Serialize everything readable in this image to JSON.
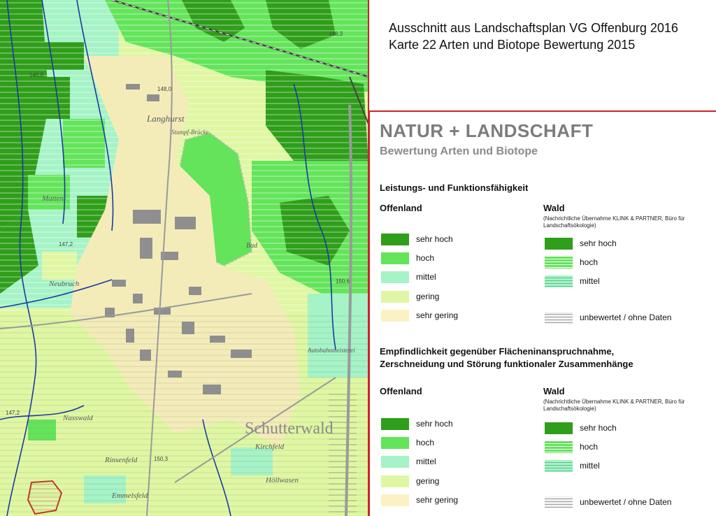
{
  "caption": {
    "line1": "Ausschnitt aus Landschaftsplan VG Offenburg 2016",
    "line2": "Karte 22 Arten und Biotope Bewertung 2015"
  },
  "map": {
    "place_labels": [
      "Langhurst",
      "Matten",
      "Neubruch",
      "Nasswald",
      "Rinsenfeld",
      "Emmelsfeld",
      "Kirchfeld",
      "Höllwasen",
      "Autobahnmeisterei",
      "Bad",
      "Schutterwald",
      "Stumpf-Brücke"
    ],
    "elevations": [
      "148,3",
      "148,0",
      "146,8",
      "147,2",
      "150,6",
      "147,2",
      "150,3"
    ],
    "colors": {
      "sehr_hoch": "#2f9e1a",
      "hoch": "#63e45a",
      "mittel": "#a5f3c6",
      "gering": "#dff7a2",
      "sehr_gering": "#fbf2c4",
      "settlement": "#f3ecb9",
      "building": "#8f8f8f",
      "water": "#1a3a9e"
    }
  },
  "legend": {
    "title": "NATUR  + LANDSCHAFT",
    "subtitle": "Bewertung Arten und Biotope",
    "section1": {
      "heading": "Leistungs- und Funktionsfähigkeit",
      "offenland": {
        "title": "Offenland",
        "items": [
          {
            "label": "sehr hoch",
            "color": "#2f9e1a"
          },
          {
            "label": "hoch",
            "color": "#63e45a"
          },
          {
            "label": "mittel",
            "color": "#a5f3c6"
          },
          {
            "label": "gering",
            "color": "#dff7a2"
          },
          {
            "label": "sehr gering",
            "color": "#fbf2c4"
          }
        ]
      },
      "wald": {
        "title": "Wald",
        "note": "(Nachrichtliche Übernahme KLINK & PARTNER, Büro für Landschaftsökologie)",
        "items": [
          {
            "label": "sehr hoch",
            "color": "#2f9e1a"
          },
          {
            "label": "hoch",
            "color": "#63e45a"
          },
          {
            "label": "mittel",
            "color": "#a5f3c6"
          },
          {
            "label": "unbewertet / ohne Daten",
            "color": "#e6e6e6"
          }
        ]
      }
    },
    "section2": {
      "heading_line1": "Empfindlichkeit gegenüber Flächeninanspruchnahme,",
      "heading_line2": "Zerschneidung und Störung funktionaler Zusammenhänge",
      "offenland": {
        "title": "Offenland",
        "items": [
          {
            "label": "sehr hoch",
            "color": "#2f9e1a"
          },
          {
            "label": "hoch",
            "color": "#63e45a"
          },
          {
            "label": "mittel",
            "color": "#a5f3c6"
          },
          {
            "label": "gering",
            "color": "#dff7a2"
          },
          {
            "label": "sehr gering",
            "color": "#fbf2c4"
          }
        ]
      },
      "wald": {
        "title": "Wald",
        "note": "(Nachrichtliche Übernahme KLINK & PARTNER, Büro für Landschaftsökologie)",
        "items": [
          {
            "label": "sehr hoch",
            "color": "#2f9e1a"
          },
          {
            "label": "hoch",
            "color": "#63e45a"
          },
          {
            "label": "mittel",
            "color": "#a5f3c6"
          },
          {
            "label": "unbewertet / ohne Daten",
            "color": "#e6e6e6"
          }
        ]
      }
    }
  }
}
